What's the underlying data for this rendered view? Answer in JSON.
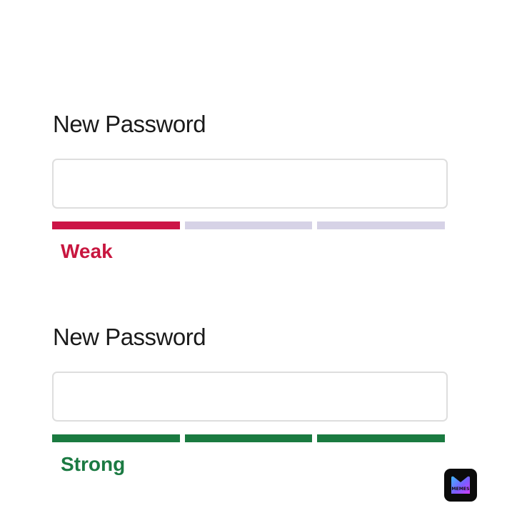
{
  "fields": [
    {
      "label": "New Password",
      "value": "",
      "strength_label": "Weak",
      "strength_level": 1,
      "strength_max": 3,
      "strength_color": "#cc1446"
    },
    {
      "label": "New Password",
      "value": "",
      "strength_label": "Strong",
      "strength_level": 3,
      "strength_max": 3,
      "strength_color": "#1a7a40"
    }
  ],
  "meter_inactive_color": "#d6d2e6",
  "watermark": {
    "text": "MEMES",
    "icon": "memes-app-logo-icon"
  }
}
